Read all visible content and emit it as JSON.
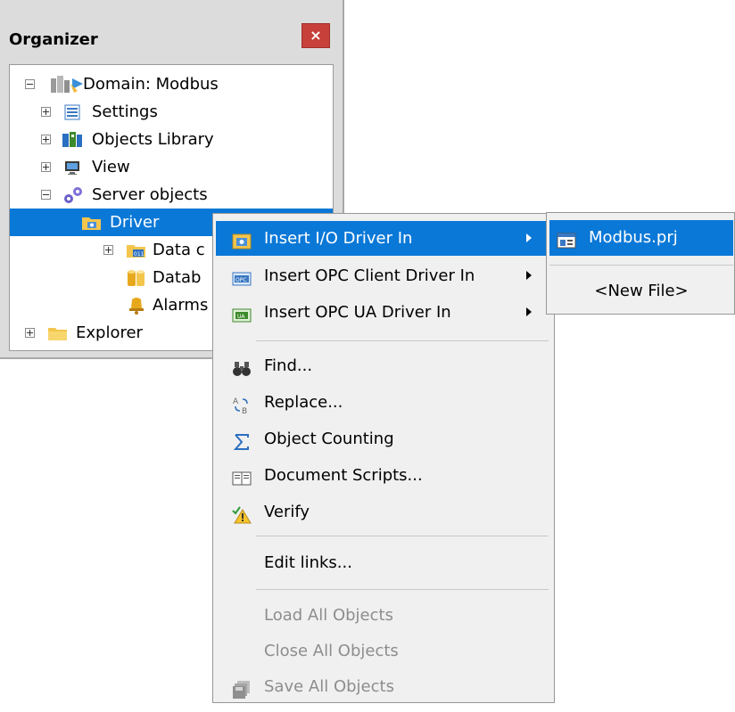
{
  "organizer": {
    "title": "Organizer",
    "close_label": "×",
    "tree": [
      {
        "label": "Domain: Modbus",
        "icon": "domain-icon",
        "expander": "minus"
      },
      {
        "label": "Settings",
        "icon": "settings-icon",
        "expander": "plus"
      },
      {
        "label": "Objects Library",
        "icon": "objects-library-icon",
        "expander": "plus"
      },
      {
        "label": "View",
        "icon": "view-icon",
        "expander": "plus"
      },
      {
        "label": "Server objects",
        "icon": "gear-icon",
        "expander": "minus"
      },
      {
        "label": "Driver",
        "icon": "drivers-folder-icon",
        "expander": "none",
        "selected": true
      },
      {
        "label": "Data c",
        "icon": "data-folder-icon",
        "expander": "plus"
      },
      {
        "label": "Datab",
        "icon": "database-icon",
        "expander": "none"
      },
      {
        "label": "Alarms",
        "icon": "alarms-icon",
        "expander": "none"
      },
      {
        "label": "Explorer",
        "icon": "explorer-folder-icon",
        "expander": "plus"
      }
    ]
  },
  "context_menu": {
    "items": [
      {
        "label": "Insert I/O Driver In",
        "icon": "io-driver-icon",
        "submenu": true,
        "active": true
      },
      {
        "label": "Insert OPC Client Driver In",
        "icon": "opc-icon",
        "submenu": true
      },
      {
        "label": "Insert OPC UA Driver In",
        "icon": "opc-ua-icon",
        "submenu": true
      },
      {
        "label": "Find...",
        "icon": "binoculars-icon"
      },
      {
        "label": "Replace...",
        "icon": "replace-icon"
      },
      {
        "label": "Object Counting",
        "icon": "sigma-icon"
      },
      {
        "label": "Document Scripts...",
        "icon": "book-icon"
      },
      {
        "label": "Verify",
        "icon": "warning-check-icon"
      },
      {
        "label": "Edit links...",
        "icon": ""
      },
      {
        "label": "Load All Objects",
        "icon": "",
        "disabled": true
      },
      {
        "label": "Close All Objects",
        "icon": "",
        "disabled": true
      },
      {
        "label": "Save All Objects",
        "icon": "save-all-icon",
        "disabled": true
      }
    ]
  },
  "submenu": {
    "items": [
      {
        "label": "Modbus.prj",
        "icon": "project-file-icon",
        "active": true
      },
      {
        "label": "<New File>",
        "icon": ""
      }
    ]
  },
  "colors": {
    "selection": "#0a78d7",
    "menu_bg": "#f0f0f0",
    "panel_bg": "#dcdcdc",
    "close_bg": "#c7403a"
  }
}
